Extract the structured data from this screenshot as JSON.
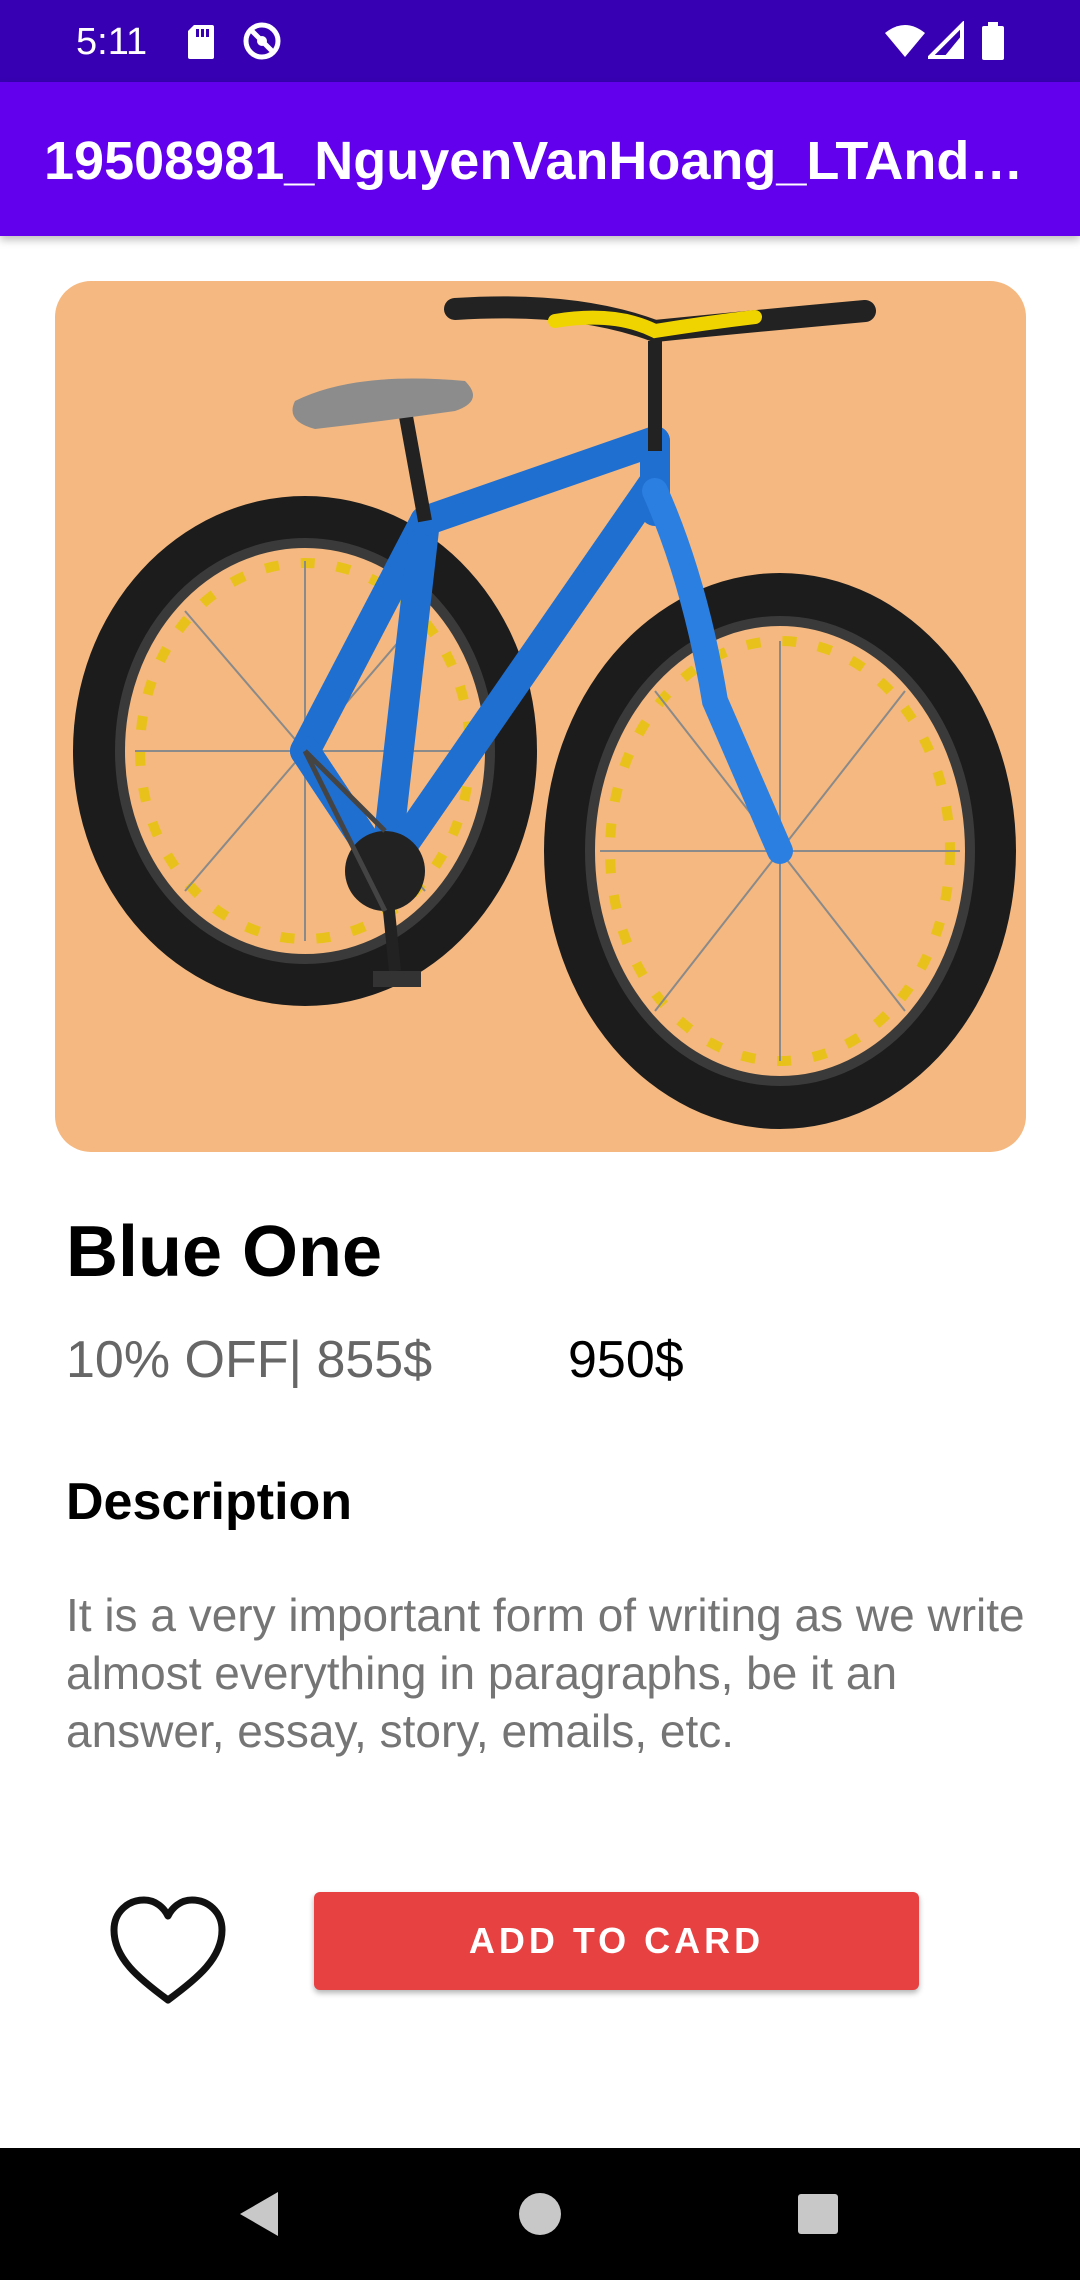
{
  "status_bar": {
    "time": "5:11",
    "left_icons": [
      "sd-card-icon",
      "do-not-disturb-icon"
    ],
    "right_icons": [
      "wifi-icon",
      "cellular-signal-icon",
      "battery-icon"
    ],
    "background": "#3700b3"
  },
  "app_bar": {
    "title": "19508981_NguyenVanHoang_LTAnd…",
    "background": "#6200ee"
  },
  "product": {
    "image_icon": "bicycle-image",
    "image_background": "#f4b880",
    "name": "Blue One",
    "discount_price": "10% OFF| 855$",
    "original_price": "950$"
  },
  "description": {
    "heading": "Description",
    "body": "It is a very important form of writing as we write almost everything in paragraphs, be it an answer, essay, story, emails, etc."
  },
  "actions": {
    "favorite_icon": "heart-outline-icon",
    "add_button_label": "ADD TO CARD",
    "add_button_color": "#e84142"
  },
  "nav_bar": {
    "buttons": [
      "back-icon",
      "home-icon",
      "recents-icon"
    ]
  }
}
